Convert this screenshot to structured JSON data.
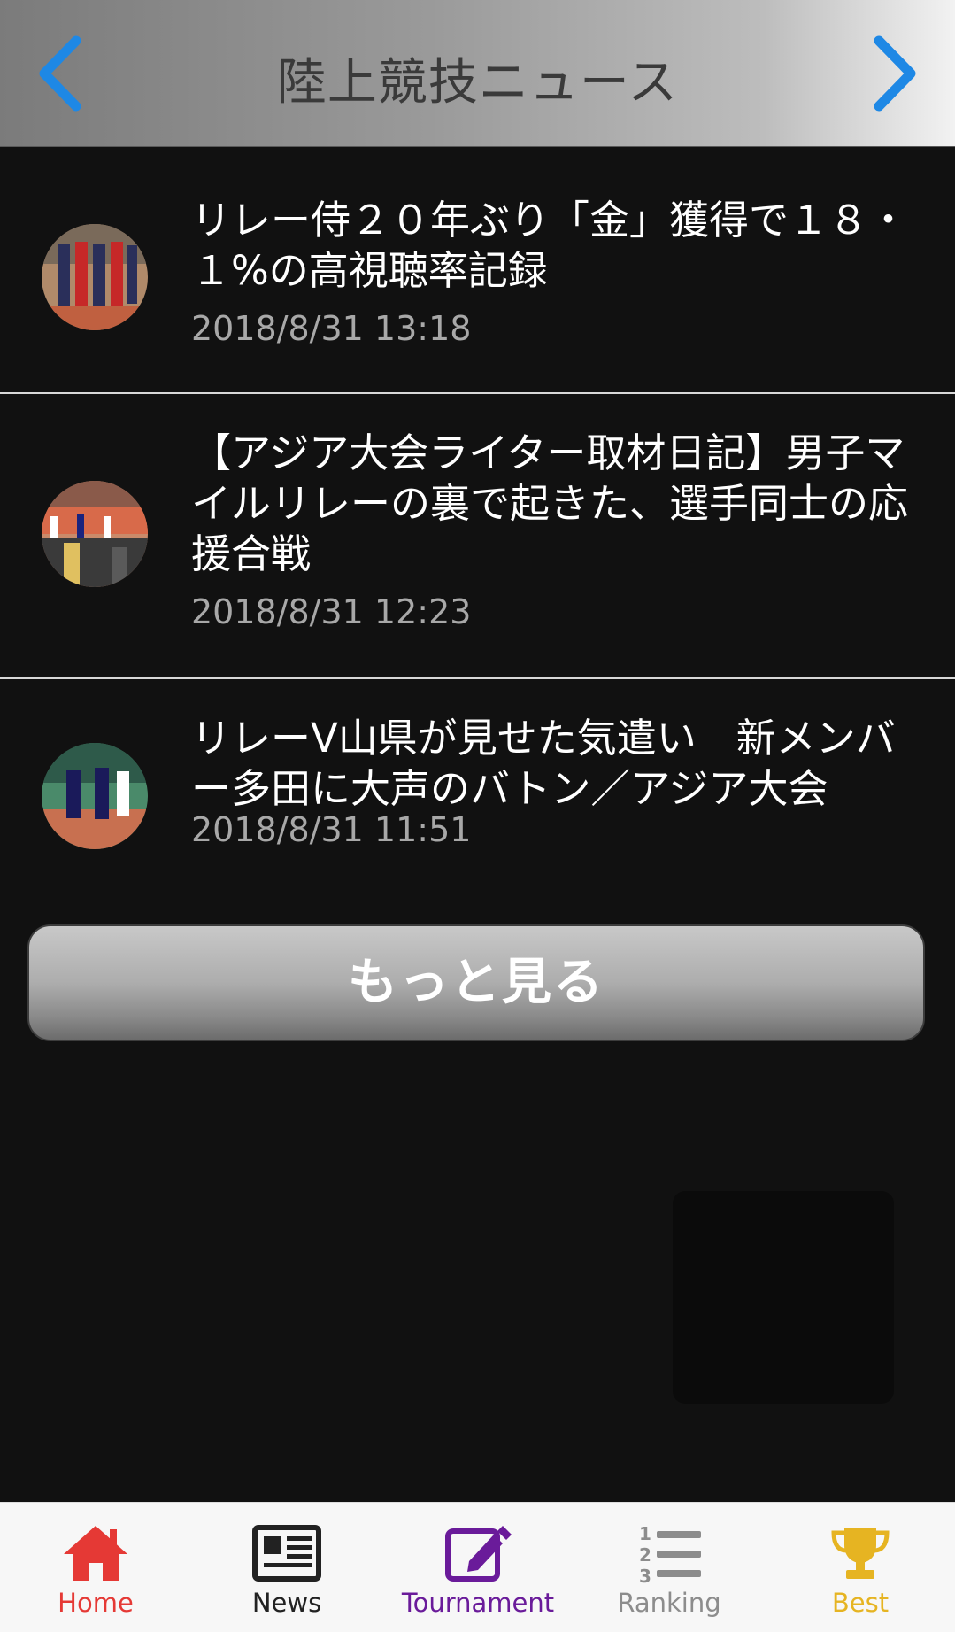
{
  "header": {
    "title": "陸上競技ニュース"
  },
  "news": [
    {
      "title": "リレー侍２０年ぶり「金」獲得で１８・１%の高視聴率記録",
      "date": "2018/8/31 13:18"
    },
    {
      "title": "【アジア大会ライター取材日記】男子マイルリレーの裏で起きた、選手同士の応援合戦",
      "date": "2018/8/31 12:23"
    },
    {
      "title": "リレーV山県が見せた気遣い　新メンバー多田に大声のバトン／アジア大会",
      "date": "2018/8/31 11:51"
    }
  ],
  "more_label": "もっと見る",
  "tabs": {
    "home": "Home",
    "news": "News",
    "tournament": "Tournament",
    "ranking": "Ranking",
    "best": "Best"
  },
  "colors": {
    "accent_blue": "#1e88e5",
    "home_red": "#e53935",
    "news_dark": "#222222",
    "tournament_purple": "#6a1b9a",
    "ranking_gray": "#8c8c8c",
    "best_gold": "#e6b422"
  }
}
